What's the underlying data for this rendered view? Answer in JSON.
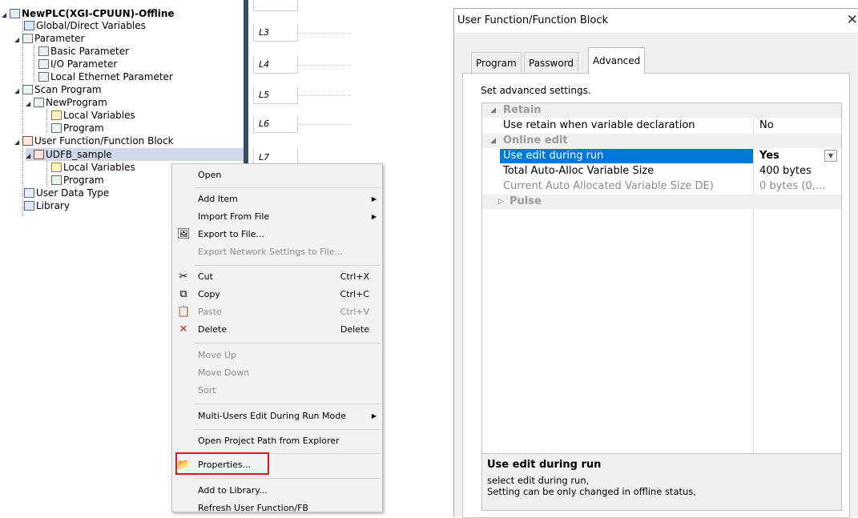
{
  "tree": {
    "root": "NewPLC(XGI-CPUUN)-Offline",
    "items": [
      {
        "label": "Global/Direct Variables"
      },
      {
        "label": "Parameter"
      },
      {
        "label": "Basic Parameter"
      },
      {
        "label": "I/O Parameter"
      },
      {
        "label": "Local Ethernet Parameter"
      },
      {
        "label": "Scan Program"
      },
      {
        "label": "NewProgram"
      },
      {
        "label": "Local Variables"
      },
      {
        "label": "Program"
      },
      {
        "label": "User Function/Function Block"
      },
      {
        "label": "UDFB_sample"
      },
      {
        "label": "Local Variables"
      },
      {
        "label": "Program"
      },
      {
        "label": "User Data Type"
      },
      {
        "label": "Library"
      }
    ]
  },
  "ladder": {
    "rows": [
      "L3",
      "L4",
      "L5",
      "L6",
      "L7"
    ]
  },
  "context_menu": {
    "items": [
      {
        "label": "Open",
        "shortcut": "",
        "disabled": false
      },
      {
        "label": "Add Item",
        "shortcut": "",
        "submenu": true
      },
      {
        "label": "Import From File",
        "shortcut": "",
        "submenu": true
      },
      {
        "label": "Export to File...",
        "shortcut": "",
        "icon": "export-icon"
      },
      {
        "label": "Export Network Settings to File...",
        "shortcut": "",
        "disabled": true
      },
      {
        "label": "Cut",
        "shortcut": "Ctrl+X",
        "icon": "scissors-icon"
      },
      {
        "label": "Copy",
        "shortcut": "Ctrl+C",
        "icon": "copy-icon"
      },
      {
        "label": "Paste",
        "shortcut": "Ctrl+V",
        "icon": "paste-icon",
        "disabled": true
      },
      {
        "label": "Delete",
        "shortcut": "Delete",
        "icon": "delete-x-icon"
      },
      {
        "label": "Move Up",
        "shortcut": "",
        "disabled": true
      },
      {
        "label": "Move Down",
        "shortcut": "",
        "disabled": true
      },
      {
        "label": "Sort",
        "shortcut": "",
        "disabled": true
      },
      {
        "label": "Multi-Users Edit During Run Mode",
        "shortcut": "",
        "submenu": true
      },
      {
        "label": "Open Project Path from Explorer",
        "shortcut": ""
      },
      {
        "label": "Properties...",
        "shortcut": "",
        "icon": "properties-folder-icon"
      },
      {
        "label": "Add to Library...",
        "shortcut": ""
      },
      {
        "label": "Refresh User Function/FB",
        "shortcut": ""
      }
    ],
    "highlight_color": "#e3161e"
  },
  "dialog": {
    "title": "User Function/Function Block",
    "close": "✕",
    "tabs": [
      "Program",
      "Password",
      "Advanced"
    ],
    "active_tab": "Advanced",
    "set_label": "Set advanced settings.",
    "grid": {
      "categories": [
        {
          "name": "Retain",
          "rows": [
            {
              "name": "Use retain when variable declaration",
              "value": "No"
            }
          ]
        },
        {
          "name": "Online edit",
          "rows": [
            {
              "name": "Use edit during run",
              "value": "Yes"
            },
            {
              "name": "Total Auto-Alloc Variable Size",
              "value": "400 bytes"
            },
            {
              "name": "Current Auto Allocated Variable Size DE)",
              "value": "0 bytes (0,..."
            }
          ]
        },
        {
          "name": "Pulse",
          "rows": []
        }
      ]
    },
    "description": {
      "title": "Use edit during run",
      "line1": "select edit during run,",
      "line2": "Setting can be only changed in offline status,"
    },
    "selection_color": "#0078d7"
  }
}
